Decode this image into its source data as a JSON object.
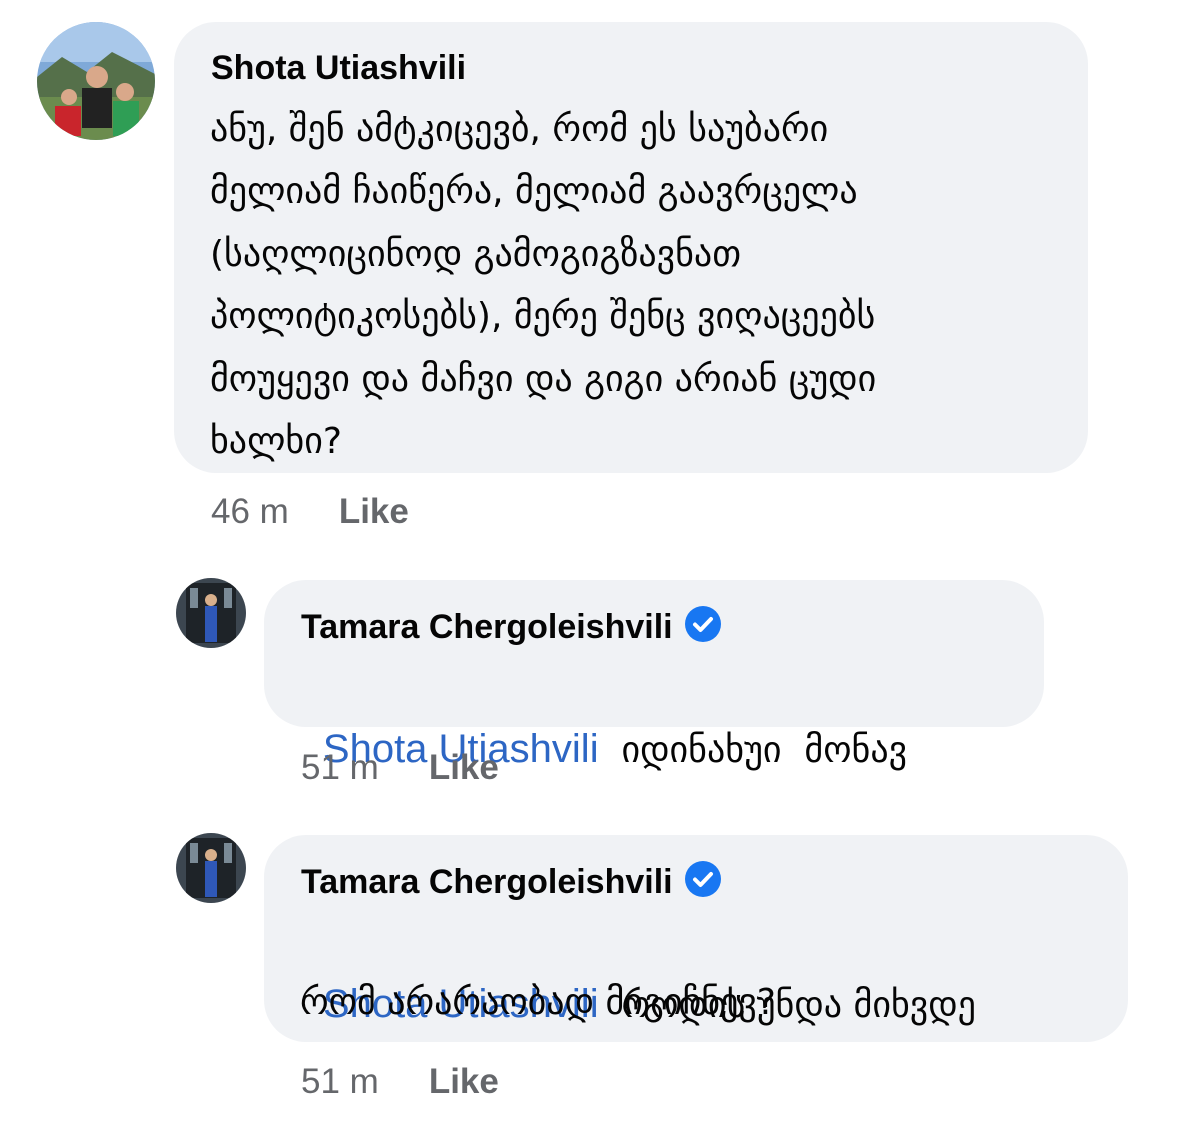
{
  "comments": [
    {
      "author": "Shota Utiashvili",
      "lines": [
        "ანუ, შენ ამტკიცევბ, რომ ეს საუბარი",
        "მელიამ ჩაიწერა, მელიამ გაავრცელა",
        "(საღლიცინოდ გამოგიგზავნათ",
        "პოლიტიკოსებს), მერე შენც ვიღაცეებს",
        "მოუყევი და მაჩვი და გიგი არიან ცუდი",
        "ხალხი?"
      ],
      "time": "46 m",
      "like": "Like"
    },
    {
      "author": "Tamara Chergoleishvili",
      "verified": true,
      "mention": "Shota Utiashvili",
      "lines": [
        "  იდინახუი  მონავ"
      ],
      "time": "51 m",
      "like": "Like"
    },
    {
      "author": "Tamara Chergoleishvili",
      "verified": true,
      "mention": "Shota Utiashvili",
      "lines": [
        "  როდის უნდა მიხვდე",
        "რომ არარაობად მიგიჩნევ?"
      ],
      "time": "51 m",
      "like": "Like"
    }
  ],
  "icons": {
    "verified": "verified-badge-icon"
  },
  "colors": {
    "bubble": "#f0f2f5",
    "mention": "#2d66c4",
    "meta": "#65676b",
    "verified": "#1877f2"
  }
}
